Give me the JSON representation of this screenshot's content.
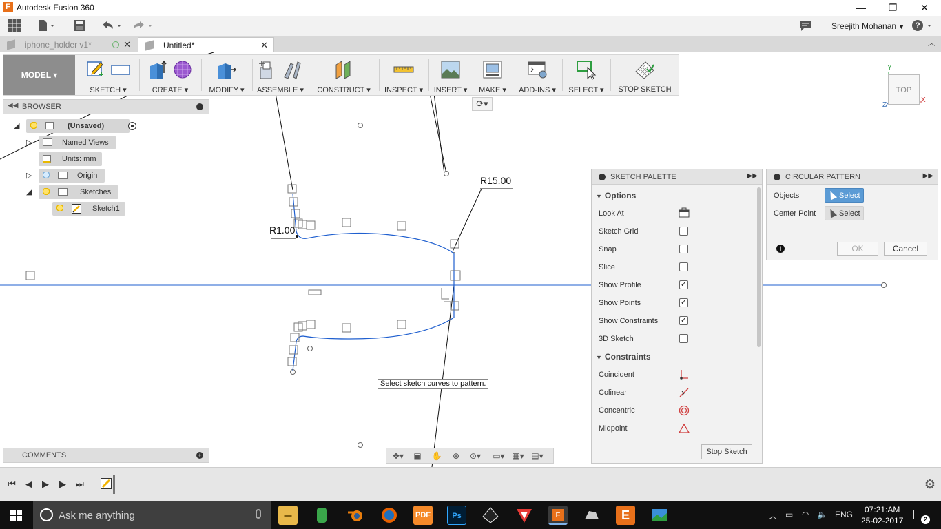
{
  "window": {
    "title": "Autodesk Fusion 360",
    "app_icon_letter": "F",
    "minimize": "—",
    "maximize": "❐",
    "close": "✕"
  },
  "qat": {
    "user_name": "Sreejith Mohanan",
    "help": "?"
  },
  "tabs": [
    {
      "label": "iphone_holder v1*",
      "active": false
    },
    {
      "label": "Untitled*",
      "active": true
    }
  ],
  "ribbon": {
    "workspace": "MODEL ▾",
    "groups": [
      "SKETCH ▾",
      "CREATE ▾",
      "MODIFY ▾",
      "ASSEMBLE ▾",
      "CONSTRUCT ▾",
      "INSPECT ▾",
      "INSERT ▾",
      "MAKE ▾",
      "ADD-INS ▾",
      "SELECT ▾",
      "STOP SKETCH"
    ]
  },
  "browser": {
    "title": "BROWSER",
    "root": "(Unsaved)",
    "items": [
      "Named Views",
      "Units: mm",
      "Origin",
      "Sketches",
      "Sketch1"
    ]
  },
  "comments": {
    "title": "COMMENTS"
  },
  "palette": {
    "title": "SKETCH PALETTE",
    "options_header": "Options",
    "options": [
      {
        "label": "Look At",
        "type": "icon"
      },
      {
        "label": "Sketch Grid",
        "checked": false
      },
      {
        "label": "Snap",
        "checked": false
      },
      {
        "label": "Slice",
        "checked": false
      },
      {
        "label": "Show Profile",
        "checked": true
      },
      {
        "label": "Show Points",
        "checked": true
      },
      {
        "label": "Show Constraints",
        "checked": true
      },
      {
        "label": "3D Sketch",
        "checked": false
      }
    ],
    "constraints_header": "Constraints",
    "constraints": [
      "Coincident",
      "Colinear",
      "Concentric",
      "Midpoint"
    ],
    "stop_button": "Stop Sketch"
  },
  "circular_pattern": {
    "title": "CIRCULAR PATTERN",
    "objects_label": "Objects",
    "objects_button": "Select",
    "center_label": "Center Point",
    "center_button": "Select",
    "ok": "OK",
    "cancel": "Cancel",
    "info": "i"
  },
  "viewcube": {
    "label": "TOP",
    "axis_y": "Y",
    "axis_x": "X",
    "axis_z": "Z"
  },
  "canvas": {
    "dim_r15": "R15.00",
    "dim_r1": "R1.00",
    "tooltip": "Select sketch curves to pattern."
  },
  "taskbar": {
    "search_placeholder": "Ask me anything",
    "language": "ENG",
    "time": "07:21:AM",
    "date": "25-02-2017",
    "notification_count": "2"
  },
  "colors": {
    "sketch_line": "#1f5fcf",
    "workspace_bg": "#8d8d8d",
    "select_active": "#5b9bd5"
  }
}
